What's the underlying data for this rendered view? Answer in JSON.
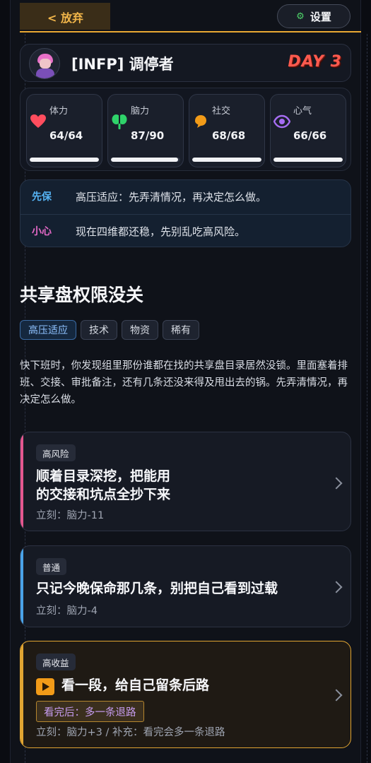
{
  "topbar": {
    "quit_label": "< 放弃",
    "settings_label": "设置",
    "settings_icon": "gear-icon"
  },
  "profile": {
    "title": "[INFP] 调停者",
    "day_label": "DAY 3"
  },
  "stats": [
    {
      "label": "体力",
      "value": "64/64",
      "icon": "heart-icon",
      "color": "#ff4d5e",
      "fill": 1.0
    },
    {
      "label": "脑力",
      "value": "87/90",
      "icon": "brain-icon",
      "color": "#2fd36a",
      "fill": 0.967
    },
    {
      "label": "社交",
      "value": "68/68",
      "icon": "chat-bubble-icon",
      "color": "#f29b18",
      "fill": 1.0
    },
    {
      "label": "心气",
      "value": "66/66",
      "icon": "eye-icon",
      "color": "#a66df2",
      "fill": 1.0
    }
  ],
  "tips": [
    {
      "key": "先保",
      "text": "高压适应：先弄清情况，再决定怎么做。",
      "color": "#56b4f5"
    },
    {
      "key": "小心",
      "text": "现在四维都还稳，先别乱吃高风险。",
      "color": "#e66ac8"
    }
  ],
  "event": {
    "title": "共享盘权限没关",
    "tags": [
      "高压适应",
      "技术",
      "物资",
      "稀有"
    ],
    "description": "快下班时，你发现组里那份谁都在找的共享盘目录居然没锁。里面塞着排班、交接、审批备注，还有几条还没来得及甩出去的锅。先弄清情况，再决定怎么做。"
  },
  "choices": [
    {
      "badge": "高风险",
      "title_line1": "顺着目录深挖，把能用",
      "title_line2": "的交接和坑点全抄下来",
      "meta": "立刻：脑力-11",
      "accent": "#e4578f"
    },
    {
      "badge": "普通",
      "title": "只记今晚保命那几条，别把自己看到过载",
      "meta": "立刻：脑力-4",
      "accent": "#4aa3e8"
    },
    {
      "badge": "高收益",
      "title": "看一段，给自己留条后路",
      "after_label": "看完后：多一条退路",
      "meta": "立刻：脑力+3 / 补充：看完会多一条退路",
      "accent": "#e1a532"
    }
  ]
}
